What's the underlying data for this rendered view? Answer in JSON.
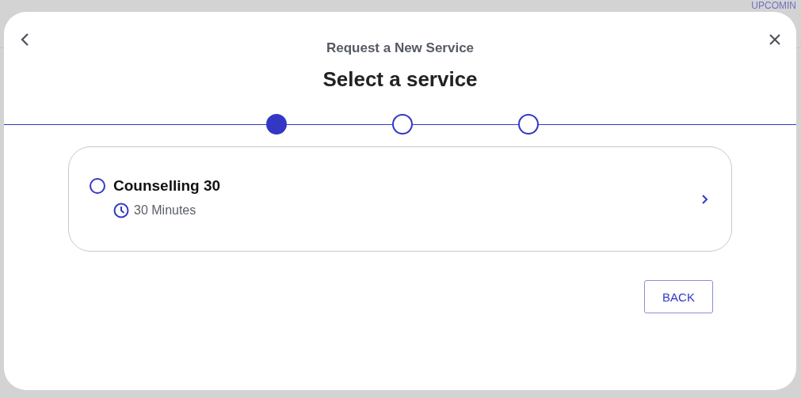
{
  "background": {
    "tab": "UPCOMIN"
  },
  "dialog": {
    "subtitle": "Request a New Service",
    "title": "Select a service",
    "steps": [
      {
        "selected": true
      },
      {
        "selected": false
      },
      {
        "selected": false
      }
    ],
    "services": [
      {
        "name": "Counselling 30",
        "duration": "30 Minutes",
        "selected": false
      }
    ],
    "buttons": [
      "BACK"
    ]
  }
}
